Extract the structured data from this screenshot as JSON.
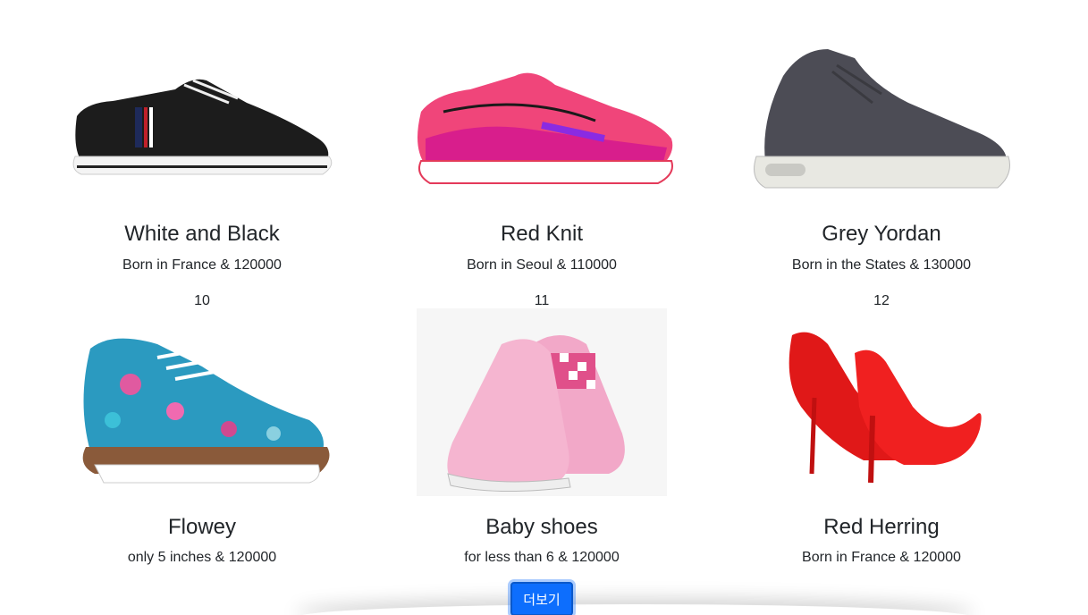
{
  "products": [
    {
      "title": "White and Black",
      "desc": "Born in France & 120000",
      "number": "10",
      "icon": "sneaker-black-icon"
    },
    {
      "title": "Red Knit",
      "desc": "Born in Seoul & 110000",
      "number": "11",
      "icon": "running-shoe-pink-icon"
    },
    {
      "title": "Grey Yordan",
      "desc": "Born in the States & 130000",
      "number": "12",
      "icon": "high-top-grey-icon"
    },
    {
      "title": "Flowey",
      "desc": "only 5 inches & 120000",
      "icon": "floral-oxford-icon"
    },
    {
      "title": "Baby shoes",
      "desc": "for less than 6 & 120000",
      "icon": "baby-slip-on-icon"
    },
    {
      "title": "Red Herring",
      "desc": "Born in France & 120000",
      "icon": "red-heels-icon"
    }
  ],
  "more_button": {
    "label": "더보기"
  },
  "colors": {
    "button": "#0d6efd",
    "text": "#212529"
  }
}
